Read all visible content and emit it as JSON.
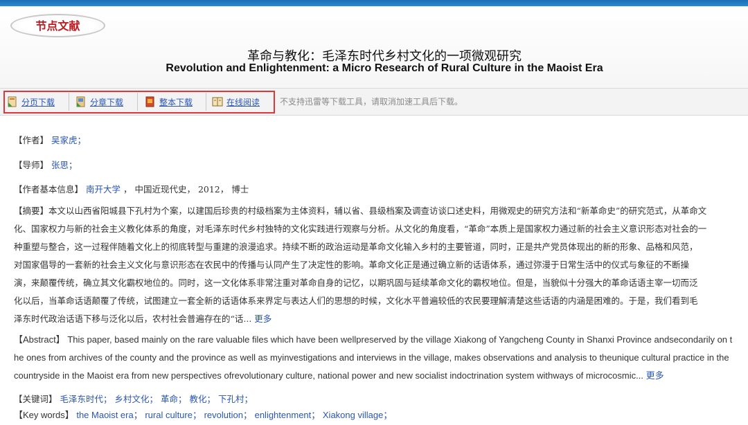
{
  "badge": "节点文献",
  "title_cn": "革命与教化：毛泽东时代乡村文化的一项微观研究",
  "title_en": "Revolution and Enlightenment: a Micro Research of Rural Culture in the Maoist Era",
  "toolbar": {
    "buttons": [
      "分页下载",
      "分章下载",
      "整本下载",
      "在线阅读"
    ],
    "notice": "不支持迅雷等下载工具，请取消加速工具后下载。"
  },
  "author": {
    "label": "【作者】",
    "value": "吴家虎；"
  },
  "advisor": {
    "label": "【导师】",
    "value": "张思；"
  },
  "info": {
    "label": "【作者基本信息】",
    "university": "南开大学",
    "rest": "， 中国近现代史， 2012， 博士"
  },
  "abstract_cn": {
    "label": "【摘要】",
    "lines": [
      "本文以山西省阳城县下孔村为个案，以建国后珍贵的村级档案为主体资料，辅以省、县级档案及调查访谈口述史料，用微观史的研究方法和“新革命史”的研究范式，从革命文",
      "化、国家权力与新的社会主义教化体系的角度，对毛泽东时代乡村独特的文化实践进行观察与分析。从文化的角度看，“革命”本质上是国家权力通过新的社会主义意识形态对社会的一",
      "种重塑与整合，这一过程伴随着文化上的彻底转型与重建的浪漫追求。持续不断的政治运动是革命文化输入乡村的主要管道，同时，正是共产党员体现出的新的形象、品格和风范，",
      "对国家倡导的一套新的社会主义文化与意识形态在农民中的传播与认同产生了决定性的影响。革命文化正是通过确立新的话语体系，通过弥漫于日常生活中的仪式与象征的不断操",
      "演，来颠覆传统，确立其文化霸权地位的。同时，这一文化体系非常注重对革命自身的记忆，以期巩固与延续革命文化的霸权地位。但是，当貌似十分强大的革命话语主宰一切而泛",
      "化以后，当革命话语颠覆了传统，试图建立一套全新的话语体系来界定与表达人们的思想的时候，文化水平普遍较低的农民要理解清楚这些话语的内涵是困难的。于是，我们看到毛",
      "泽东时代政治话语下移与泛化以后，农村社会普遍存在的“话..."
    ],
    "more": "更多"
  },
  "abstract_en": {
    "label": "【Abstract】",
    "lines": [
      "This paper, based mainly on the rare valuable files which have been wellpreserved by the village Xiakong of Yangcheng County in Shanxi Province andsecondarily on t",
      "he ones from archives of the county and the province as well as myinvestigations and interviews in the village, makes observations and analysis to theunique cultural practice in the",
      "countryside in the Maoist era from new perspectives ofrevolutionary culture, national power and new socialist indoctrination system withways of microcosmic..."
    ],
    "more": "更多"
  },
  "keywords_cn": {
    "label": "【关键词】",
    "items": [
      "毛泽东时代；",
      "乡村文化；",
      "革命；",
      "教化；",
      "下孔村；"
    ]
  },
  "keywords_en": {
    "label": "【Key words】",
    "items": [
      "the Maoist era；",
      "rural culture；",
      "revolution；",
      "enlightenment；",
      "Xiakong village；"
    ]
  },
  "colors": {
    "topbar": "#1f78c4",
    "link": "#2a55b4",
    "highlight_box": "#e0363b",
    "badge_text": "#c0181e"
  },
  "icons": [
    "page-download-icon",
    "chapter-download-icon",
    "book-download-icon",
    "read-online-icon"
  ]
}
